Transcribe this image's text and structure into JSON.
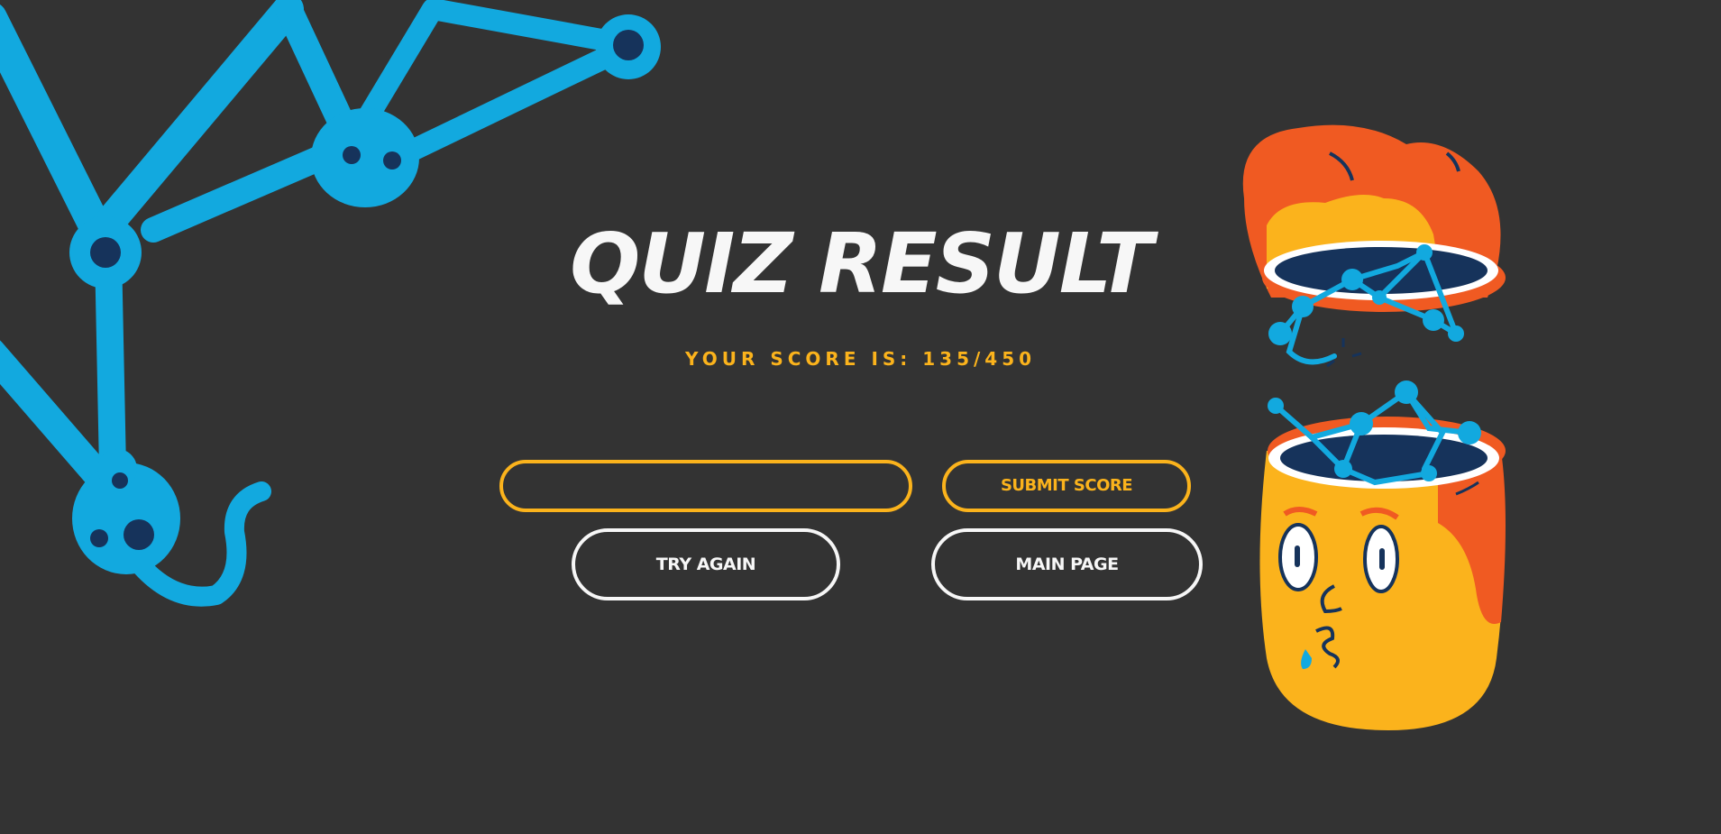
{
  "page": {
    "title": "QUIZ RESULT",
    "score_text": "YOUR SCORE IS: 135/450"
  },
  "form": {
    "name_input_value": "",
    "name_input_placeholder": "",
    "submit_label": "SUBMIT SCORE"
  },
  "actions": {
    "try_again_label": "TRY AGAIN",
    "main_page_label": "MAIN PAGE"
  },
  "colors": {
    "background": "#333333",
    "accent_yellow": "#fbb31c",
    "text_white": "#f7f7f7",
    "molecule_blue": "#12a9df",
    "node_navy": "#16335b",
    "hair_orange": "#f05a22"
  },
  "illustrations": {
    "left": "molecule-illustration",
    "right": "open-head-brain-network-illustration"
  }
}
